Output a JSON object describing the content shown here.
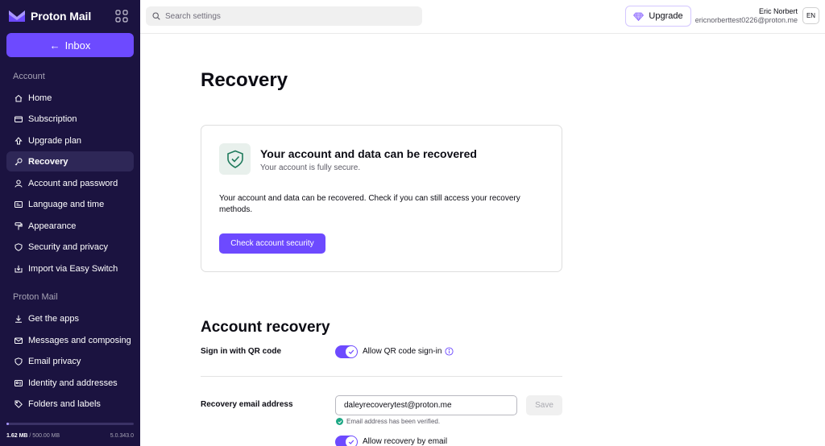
{
  "app": {
    "brand_name": "Proton Mail",
    "accent": "#6d4aff",
    "sidebar_bg": "#1b1340"
  },
  "sidebar": {
    "inbox_label": "Inbox",
    "sections": [
      {
        "label": "Account"
      },
      {
        "label": "Proton Mail"
      }
    ],
    "account_items": [
      {
        "label": "Home",
        "icon": "home-icon"
      },
      {
        "label": "Subscription",
        "icon": "credit-card-icon"
      },
      {
        "label": "Upgrade plan",
        "icon": "upgrade-icon"
      },
      {
        "label": "Recovery",
        "icon": "key-icon",
        "active": true
      },
      {
        "label": "Account and password",
        "icon": "user-icon"
      },
      {
        "label": "Language and time",
        "icon": "language-icon"
      },
      {
        "label": "Appearance",
        "icon": "paint-roller-icon"
      },
      {
        "label": "Security and privacy",
        "icon": "shield-icon"
      },
      {
        "label": "Import via Easy Switch",
        "icon": "import-icon"
      }
    ],
    "mail_items": [
      {
        "label": "Get the apps",
        "icon": "download-icon"
      },
      {
        "label": "Messages and composing",
        "icon": "envelope-icon"
      },
      {
        "label": "Email privacy",
        "icon": "shield-icon"
      },
      {
        "label": "Identity and addresses",
        "icon": "card-identity-icon"
      },
      {
        "label": "Folders and labels",
        "icon": "tag-icon"
      }
    ],
    "storage_used": "1.62 MB",
    "storage_total": "/ 500.00 MB",
    "storage_fraction": 0.003,
    "version": "5.0.343.0"
  },
  "topbar": {
    "search_placeholder": "Search settings",
    "upgrade_label": "Upgrade",
    "user_name": "Eric Norbert",
    "user_email": "ericnorberttest0226@proton.me",
    "language": "EN"
  },
  "main": {
    "page_title": "Recovery",
    "status_card": {
      "title": "Your account and data can be recovered",
      "subtitle": "Your account is fully secure.",
      "body": "Your account and data can be recovered. Check if you can still access your recovery methods.",
      "button": "Check account security"
    },
    "account_recovery": {
      "title": "Account recovery",
      "qr_label": "Sign in with QR code",
      "qr_toggle_label": "Allow QR code sign-in",
      "qr_toggle_on": true,
      "email_label": "Recovery email address",
      "email_value": "daleyrecoverytest@proton.me",
      "save_label": "Save",
      "verified_text": "Email address has been verified.",
      "email_toggle_label": "Allow recovery by email",
      "email_toggle_on": true
    }
  }
}
